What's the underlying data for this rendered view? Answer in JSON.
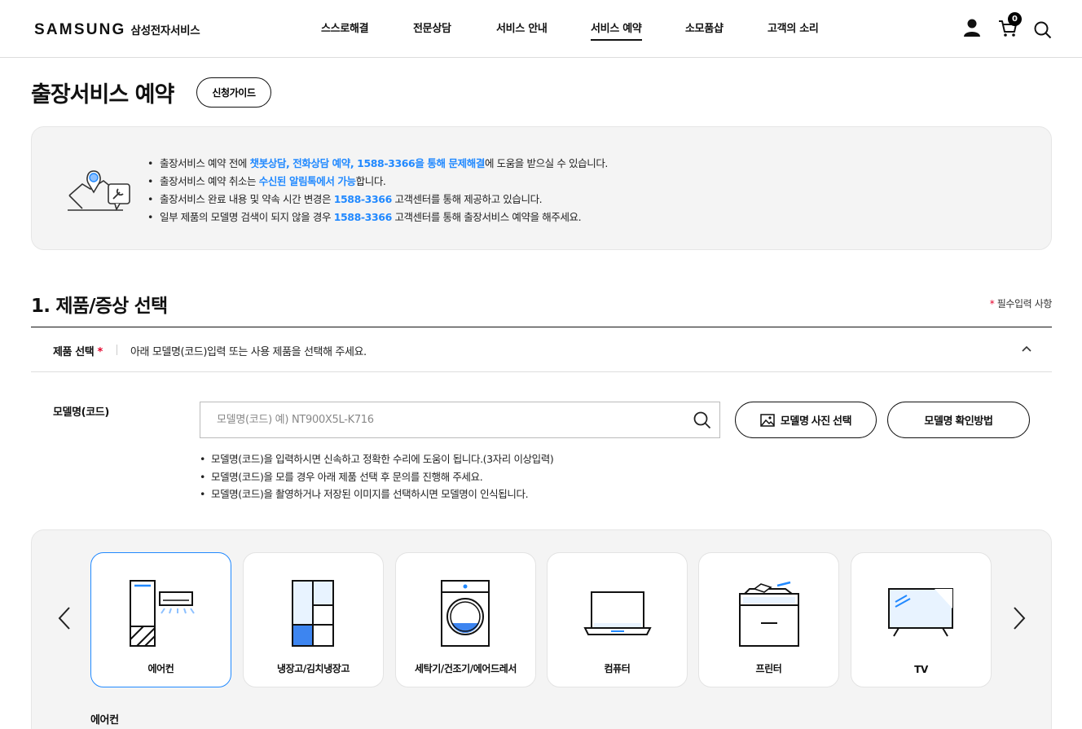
{
  "header": {
    "logo_word": "SAMSUNG",
    "logo_sub": "삼성전자서비스",
    "nav": [
      {
        "label": "스스로해결",
        "active": false
      },
      {
        "label": "전문상담",
        "active": false
      },
      {
        "label": "서비스 안내",
        "active": false
      },
      {
        "label": "서비스 예약",
        "active": true
      },
      {
        "label": "소모품샵",
        "active": false
      },
      {
        "label": "고객의 소리",
        "active": false
      }
    ],
    "icons": [
      "user-icon",
      "cart-icon",
      "search-icon"
    ],
    "cart_count": "0"
  },
  "page": {
    "title": "출장서비스 예약",
    "guide_button": "신청가이드"
  },
  "notice": {
    "icon": "map-pin-wrench-icon",
    "items": [
      {
        "parts": [
          {
            "text": "출장서비스 예약 전에 ",
            "hl": false
          },
          {
            "text": "챗봇상담, 전화상담 예약, 1588-3366을 통해 문제해결",
            "hl": true
          },
          {
            "text": "에 도움을 받으실 수 있습니다.",
            "hl": false
          }
        ]
      },
      {
        "parts": [
          {
            "text": "출장서비스 예약 취소는 ",
            "hl": false
          },
          {
            "text": "수신된 알림톡에서 가능",
            "hl": true
          },
          {
            "text": "합니다.",
            "hl": false
          }
        ]
      },
      {
        "parts": [
          {
            "text": "출장서비스 완료 내용 및 약속 시간 변경은 ",
            "hl": false
          },
          {
            "text": "1588-3366",
            "hl": true
          },
          {
            "text": " 고객센터를 통해 제공하고 있습니다.",
            "hl": false
          }
        ]
      },
      {
        "parts": [
          {
            "text": "일부 제품의 모델명 검색이 되지 않을 경우 ",
            "hl": false
          },
          {
            "text": "1588-3366",
            "hl": true
          },
          {
            "text": " 고객센터를 통해 출장서비스 예약을 해주세요.",
            "hl": false
          }
        ]
      }
    ]
  },
  "section": {
    "title": "1. 제품/증상 선택",
    "required_star": "*",
    "required_note": "필수입력 사항",
    "product_label": "제품 선택",
    "product_star": "*",
    "product_desc": "아래 모델명(코드)입력 또는 사용 제품을 선택해 주세요."
  },
  "model": {
    "label": "모델명(코드)",
    "value": "",
    "placeholder": "모델명(코드) 예) NT900X5L-K716",
    "photo_button": "모델명 사진 선택",
    "check_button": "모델명 확인방법",
    "notes": [
      "모델명(코드)을 입력하시면 신속하고 정확한 수리에 도움이 됩니다.(3자리 이상입력)",
      "모델명(코드)을 모를 경우 아래 제품 선택 후 문의를 진행해 주세요.",
      "모델명(코드)을 촬영하거나 저장된 이미지를 선택하시면 모델명이 인식됩니다."
    ]
  },
  "categories": {
    "items": [
      {
        "label": "에어컨",
        "icon": "air-conditioner-icon",
        "selected": true
      },
      {
        "label": "냉장고/김치냉장고",
        "icon": "refrigerator-icon",
        "selected": false
      },
      {
        "label": "세탁기/건조기/에어드레서",
        "icon": "washing-machine-icon",
        "selected": false
      },
      {
        "label": "컴퓨터",
        "icon": "laptop-icon",
        "selected": false
      },
      {
        "label": "프린터",
        "icon": "printer-icon",
        "selected": false
      },
      {
        "label": "TV",
        "icon": "tv-icon",
        "selected": false
      }
    ],
    "selected_label": "에어컨"
  },
  "colors": {
    "accent": "#2189ff",
    "required": "#e4002b",
    "panel": "#f4f4f4"
  }
}
